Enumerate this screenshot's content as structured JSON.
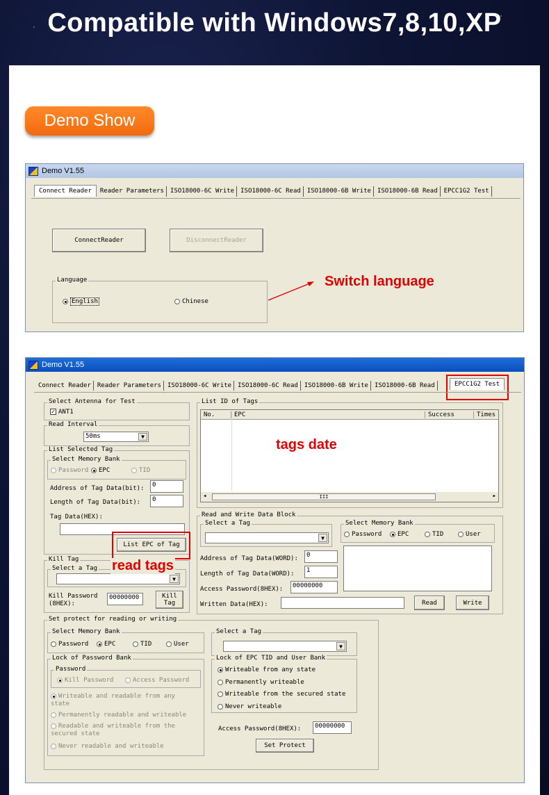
{
  "headline": "Compatible with Windows7,8,10,XP",
  "badge": "Demo Show",
  "window1": {
    "title": "Demo V1.55",
    "tabs": [
      "Connect Reader",
      "Reader Parameters",
      "ISO18000-6C Write",
      "ISO18000-6C Read",
      "ISO18000-6B Write",
      "ISO18000-6B Read",
      "EPCC1G2 Test"
    ],
    "connect_btn": "ConnectReader",
    "disconnect_btn": "DisconnectReader",
    "language_group": "Language",
    "english": "English",
    "chinese": "Chinese",
    "annotation": "Switch language"
  },
  "window2": {
    "title": "Demo V1.55",
    "tabs": [
      "Connect Reader",
      "Reader Parameters",
      "ISO18000-6C Write",
      "ISO18000-6C Read",
      "ISO18000-6B Write",
      "ISO18000-6B Read",
      "EPCC1G2 Test"
    ],
    "select_antenna": "Select Antenna for Test",
    "ant1": "ANT1",
    "read_interval": "Read Interval",
    "interval_value": "50ms",
    "list_selected_tag": "List Selected Tag",
    "select_memory_bank": "Select Memory Bank",
    "password": "Password",
    "epc": "EPC",
    "tid": "TID",
    "user": "User",
    "addr_bit": "Address of Tag Data(bit):",
    "addr_bit_val": "0",
    "len_bit": "Length of Tag Data(bit):",
    "len_bit_val": "0",
    "tag_data_hex": "Tag Data(HEX):",
    "list_epc_btn": "List EPC of Tag",
    "kill_tag": "Kill Tag",
    "select_a_tag": "Select a Tag",
    "kill_password": "Kill Password (8HEX):",
    "kill_password_val": "00000000",
    "kill_tag_btn": "Kill Tag",
    "list_id": "List ID of Tags",
    "cols": [
      "No.",
      "EPC",
      "Success",
      "Times"
    ],
    "scroll_mid": "III",
    "rw_block": "Read and Write Data Block",
    "addr_word": "Address of Tag Data(WORD):",
    "addr_word_val": "0",
    "len_word": "Length of Tag Data(WORD):",
    "len_word_val": "1",
    "access_pwd": "Access Password(8HEX):",
    "access_pwd_val": "00000000",
    "written_data": "Written Data(HEX):",
    "read_btn": "Read",
    "write_btn": "Write",
    "set_protect_group": "Set protect for reading or writing",
    "lock_pwd_bank": "Lock of Password Bank",
    "password_sub": "Password",
    "kill_password_opt": "Kill Password",
    "access_password_opt": "Access Password",
    "opt_wr_any": "Writeable and readable from any state",
    "opt_perm_rw": "Permanently readable and writeable",
    "opt_rw_secured": "Readable and writeable from the secured state",
    "opt_never_rw": "Never readable and writeable",
    "lock_epc_tid": "Lock of EPC TID and User Bank",
    "opt_w_any": "Writeable from any state",
    "opt_perm_w": "Permanently writeable",
    "opt_w_secured": "Writeable from the secured state",
    "opt_never_w": "Never writeable",
    "access_pwd2_val": "00000000",
    "set_protect_btn": "Set Protect",
    "annot_tags": "tags date",
    "annot_read": "read tags"
  }
}
